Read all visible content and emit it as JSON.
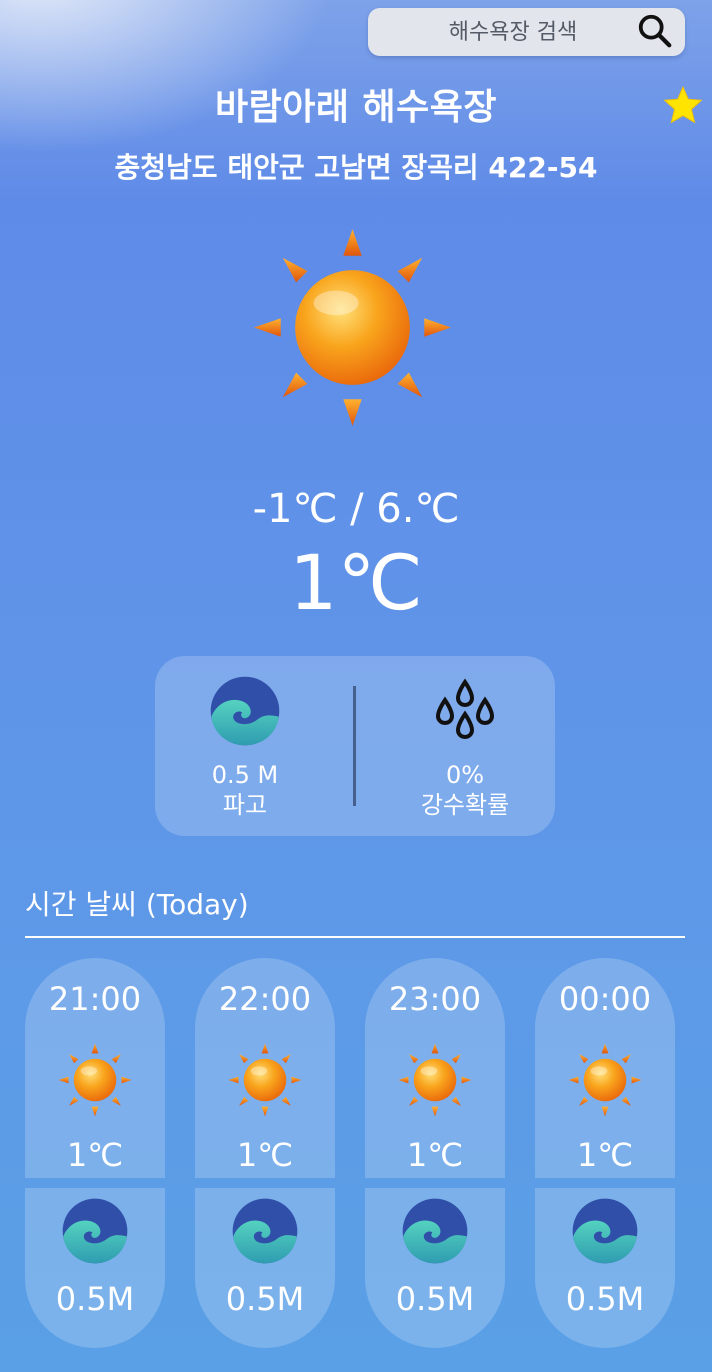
{
  "search": {
    "placeholder": "해수욕장 검색"
  },
  "beach": {
    "name": "바람아래 해수욕장",
    "address": "충청남도 태안군 고남면 장곡리 422-54"
  },
  "weather": {
    "icon": "sun-icon",
    "min_max": "-1℃ / 6.℃",
    "current": "1℃"
  },
  "summary": {
    "wave_height": "0.5 M",
    "wave_label": "파고",
    "precip": "0%",
    "precip_label": "강수확률"
  },
  "hourly": {
    "title": "시간 날씨 (Today)",
    "items": [
      {
        "time": "21:00",
        "temp": "1℃",
        "wave": "0.5M",
        "icon": "sun-icon"
      },
      {
        "time": "22:00",
        "temp": "1℃",
        "wave": "0.5M",
        "icon": "sun-icon"
      },
      {
        "time": "23:00",
        "temp": "1℃",
        "wave": "0.5M",
        "icon": "sun-icon"
      },
      {
        "time": "00:00",
        "temp": "1℃",
        "wave": "0.5M",
        "icon": "sun-icon"
      }
    ]
  },
  "colors": {
    "favorite_star": "#ffe400",
    "wave_dark": "#2f4fa8",
    "wave_light": "#3fbfb6",
    "sun_orange": "#f28a12"
  }
}
